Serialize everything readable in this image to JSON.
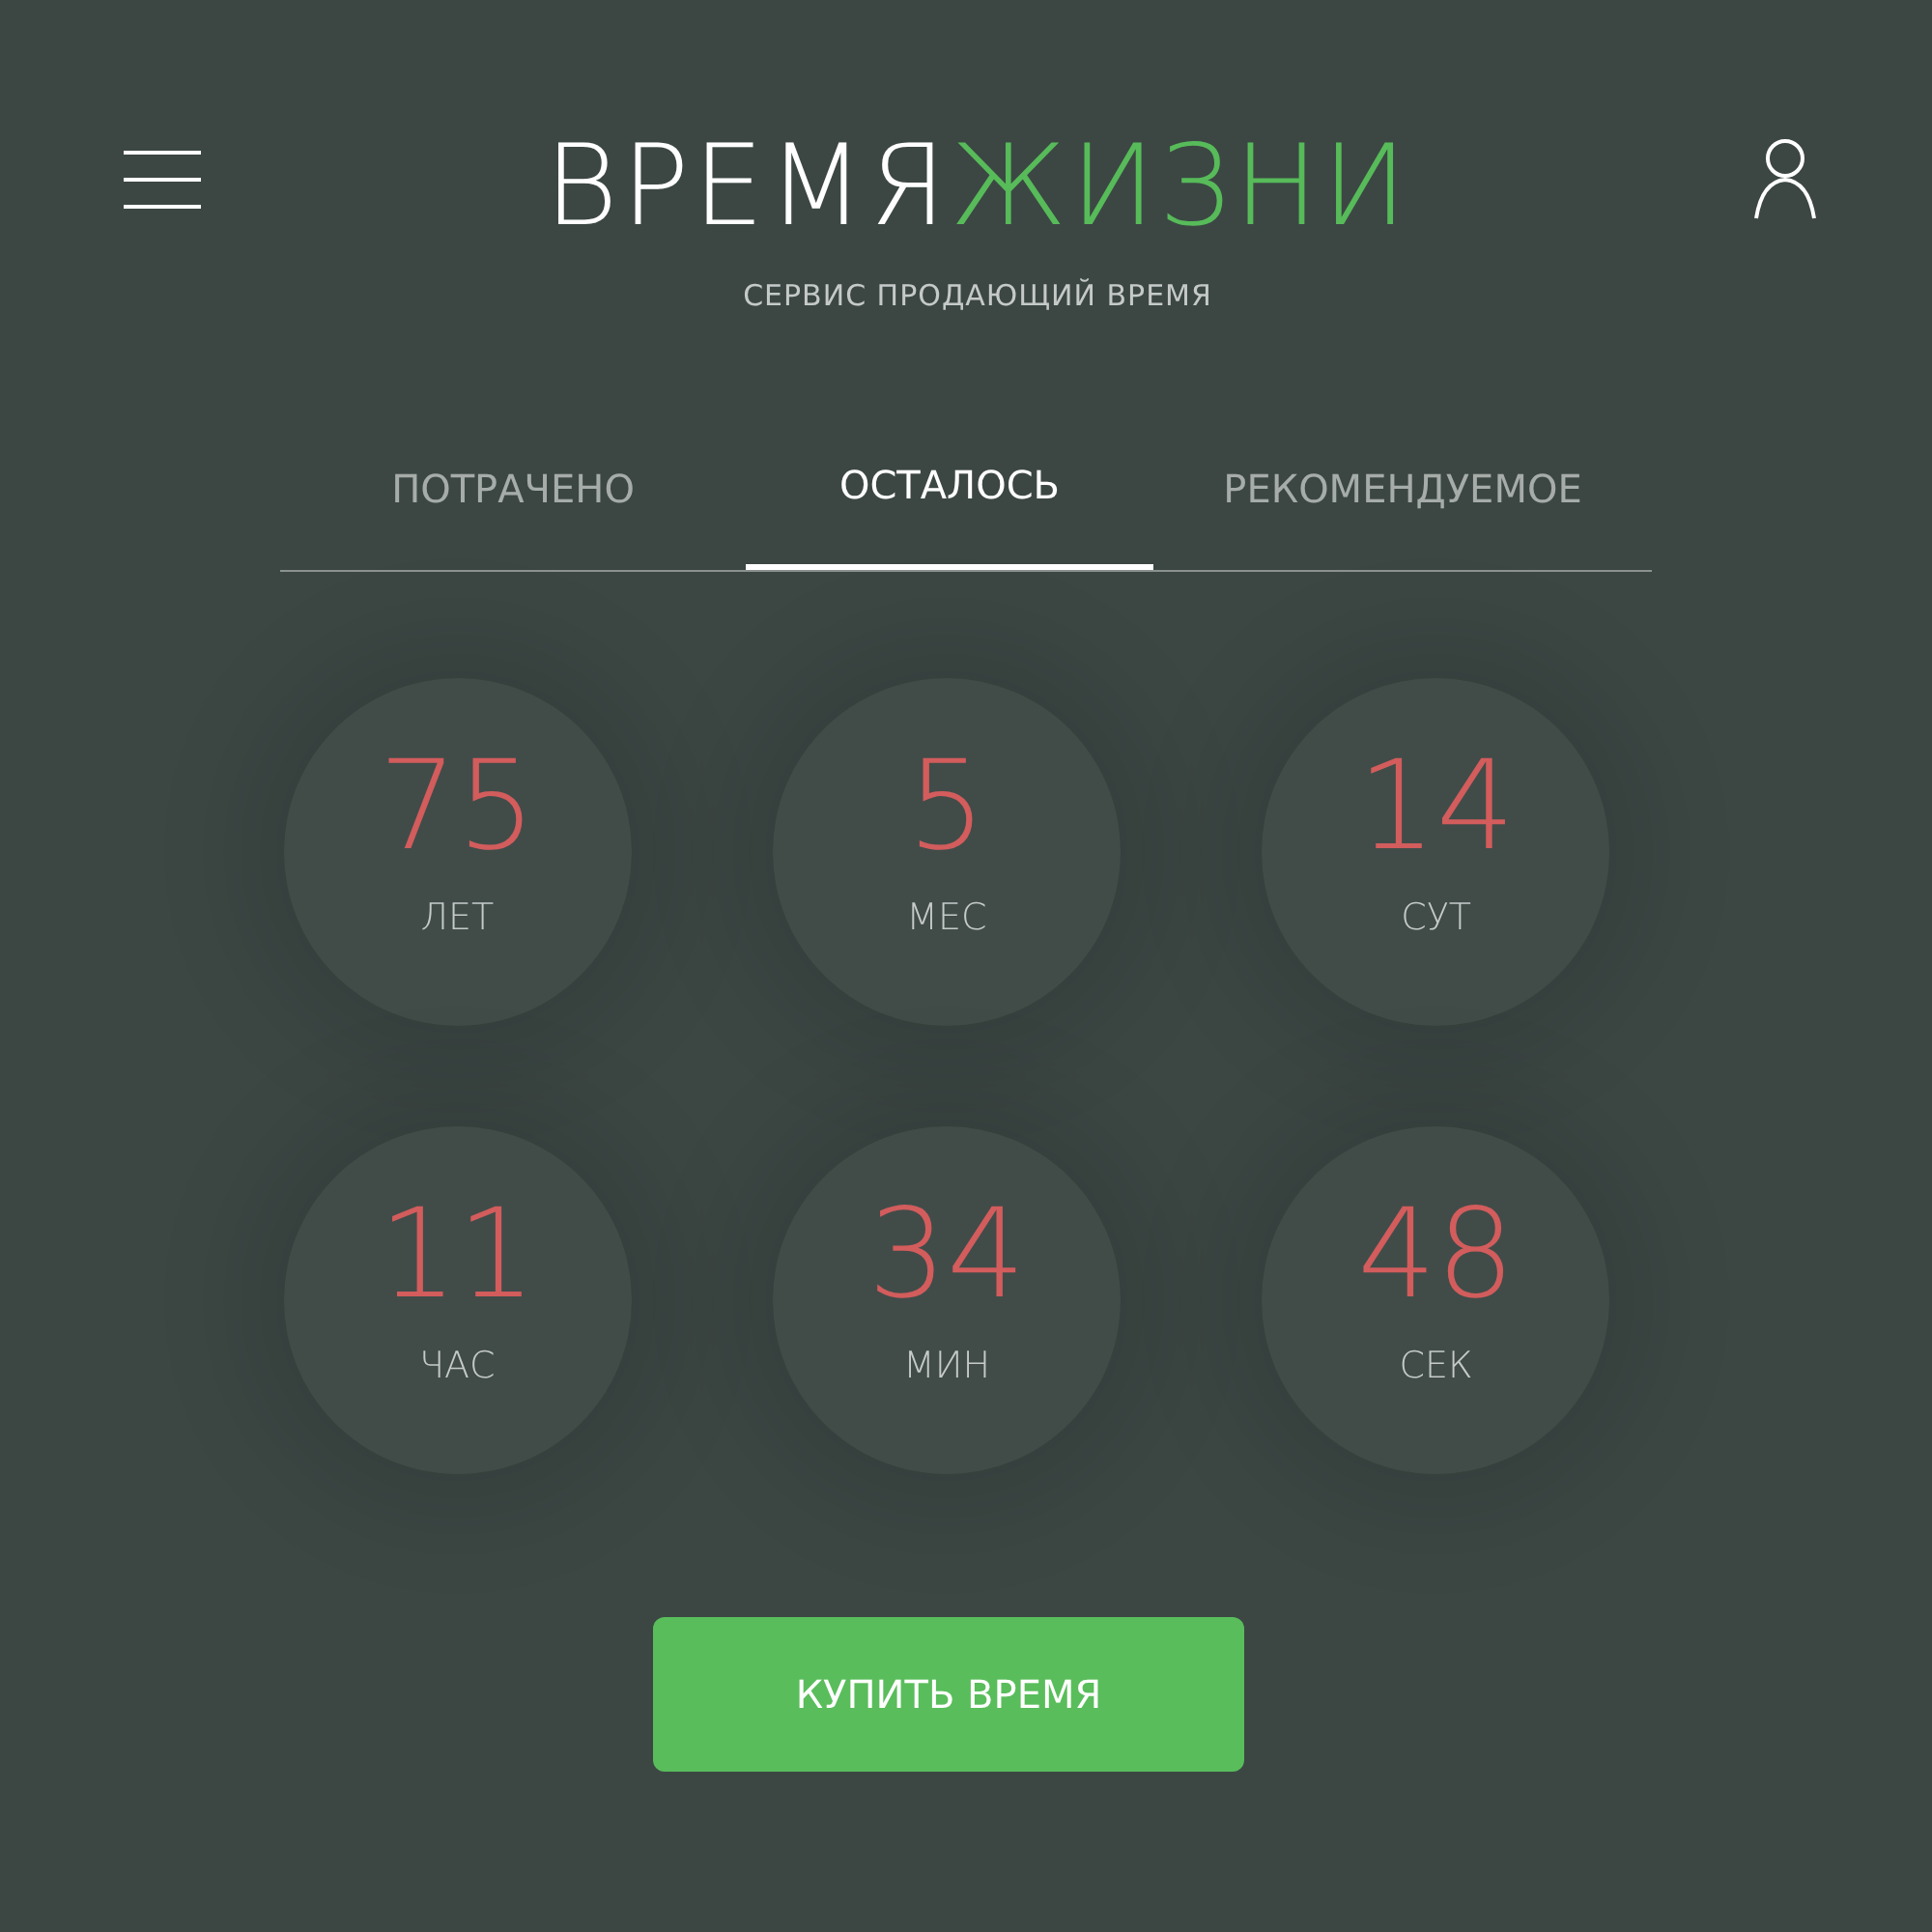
{
  "header": {
    "title_main": "ВРЕМЯ",
    "title_accent": "ЖИЗНИ",
    "subtitle": "СЕРВИС ПРОДАЮЩИЙ ВРЕМЯ"
  },
  "tabs": [
    {
      "label": "ПОТРАЧЕНО",
      "selected": false
    },
    {
      "label": "ОСТАЛОСЬ",
      "selected": true
    },
    {
      "label": "РЕКОМЕНДУЕМОЕ",
      "selected": false
    }
  ],
  "counters": [
    {
      "value": "75",
      "unit": "ЛЕТ"
    },
    {
      "value": "5",
      "unit": "МЕС"
    },
    {
      "value": "14",
      "unit": "СУТ"
    },
    {
      "value": "11",
      "unit": "ЧАС"
    },
    {
      "value": "34",
      "unit": "МИН"
    },
    {
      "value": "48",
      "unit": "СЕК"
    }
  ],
  "button": {
    "label": "КУПИТЬ ВРЕМЯ"
  }
}
